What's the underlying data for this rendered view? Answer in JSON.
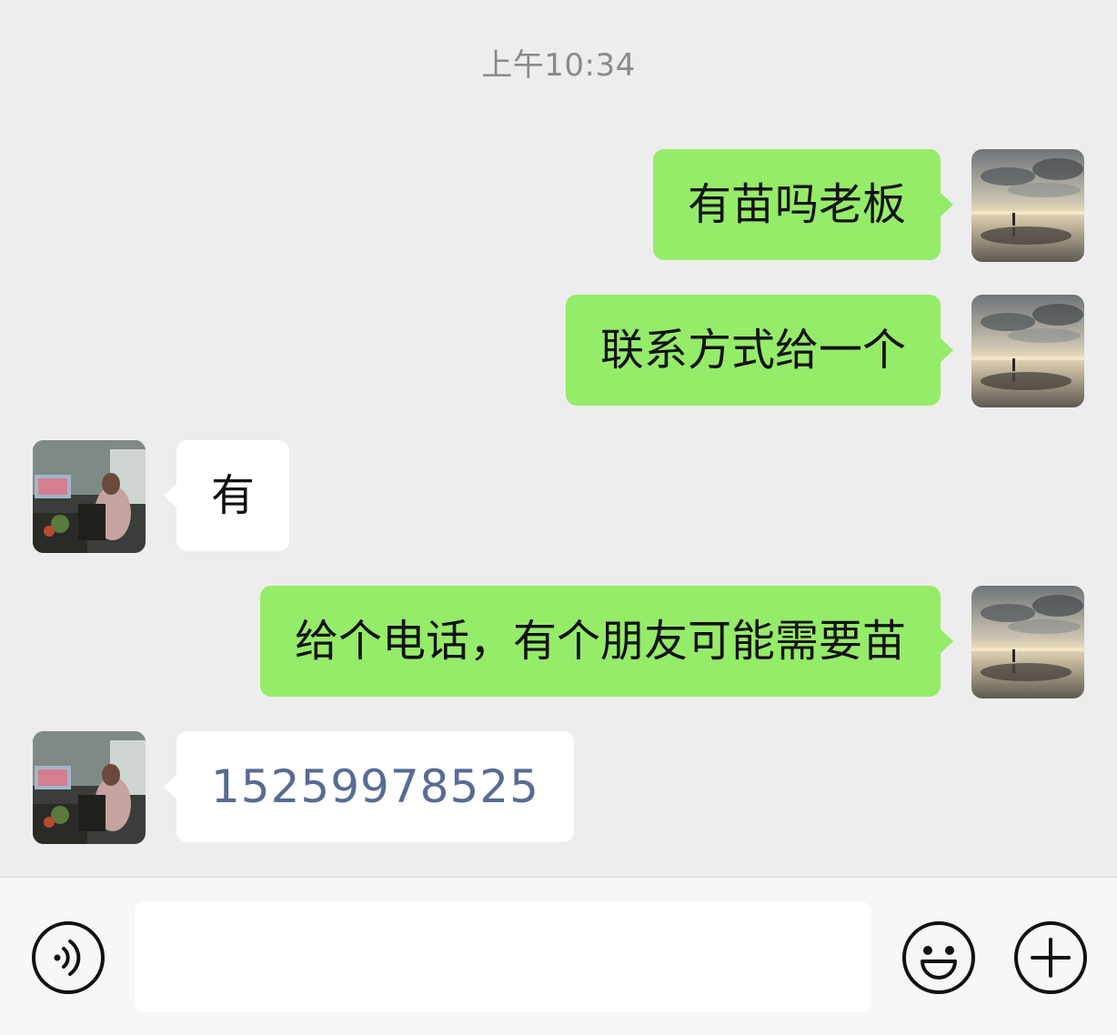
{
  "timestamp": "上午10:34",
  "messages": [
    {
      "side": "out",
      "text": "有苗吗老板"
    },
    {
      "side": "out",
      "text": "联系方式给一个"
    },
    {
      "side": "in",
      "text": "有"
    },
    {
      "side": "out",
      "text": "给个电话，有个朋友可能需要苗"
    },
    {
      "side": "in",
      "text": "15259978525"
    }
  ],
  "input_bar": {
    "message_value": "",
    "voice_icon": "voice-icon",
    "emoji_icon": "emoji-icon",
    "more_icon": "plus-icon"
  },
  "colors": {
    "background": "#ededed",
    "outgoing_bubble": "#95ec69",
    "incoming_bubble": "#ffffff",
    "link_text": "#576b95",
    "timestamp_text": "#8a8a8a"
  }
}
